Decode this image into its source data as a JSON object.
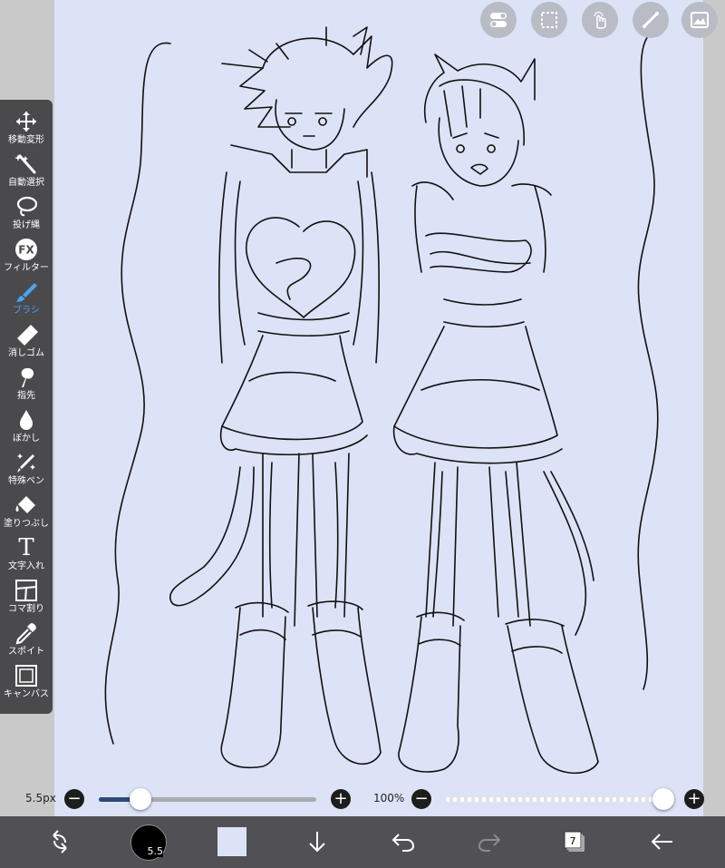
{
  "tools": [
    {
      "label": "移動変形",
      "icon": "move-icon"
    },
    {
      "label": "自動選択",
      "icon": "magic-wand-icon"
    },
    {
      "label": "投げ縄",
      "icon": "lasso-icon"
    },
    {
      "label": "フィルター",
      "icon": "fx-icon",
      "glyph": "FX"
    },
    {
      "label": "ブラシ",
      "icon": "brush-icon",
      "active": true
    },
    {
      "label": "消しゴム",
      "icon": "eraser-icon"
    },
    {
      "label": "指先",
      "icon": "smudge-icon"
    },
    {
      "label": "ぼかし",
      "icon": "blur-drop-icon"
    },
    {
      "label": "特殊ペン",
      "icon": "special-pen-icon"
    },
    {
      "label": "塗りつぶし",
      "icon": "fill-bucket-icon"
    },
    {
      "label": "文字入れ",
      "icon": "text-icon",
      "glyph": "T"
    },
    {
      "label": "コマ割り",
      "icon": "frame-divider-icon"
    },
    {
      "label": "スポイト",
      "icon": "eyedropper-icon"
    },
    {
      "label": "キャンバス",
      "icon": "canvas-icon"
    }
  ],
  "top_buttons": [
    "toggle-icon",
    "selection-icon",
    "touch-icon",
    "ruler-icon",
    "layer-image-icon"
  ],
  "brush": {
    "size_label": "5.5px",
    "size_fraction": 0.19,
    "button_value": "5.5"
  },
  "opacity": {
    "label": "100%",
    "fraction": 1.0
  },
  "layers": {
    "count": "7"
  },
  "colors": {
    "paper": "#dde3f6",
    "stroke": "#111111",
    "panel": "#4a4a4d",
    "active_tool": "#4aa3f0",
    "toolbar": "#515155",
    "slider_fill": "#2b4a78",
    "current_color_swatch": "#dde3f6"
  },
  "bottom_icons": [
    "rotate-canvas-icon",
    "brush-size-button",
    "color-swatch",
    "import-down-arrow-icon",
    "undo-icon",
    "redo-icon",
    "layers-icon",
    "back-arrow-icon"
  ]
}
